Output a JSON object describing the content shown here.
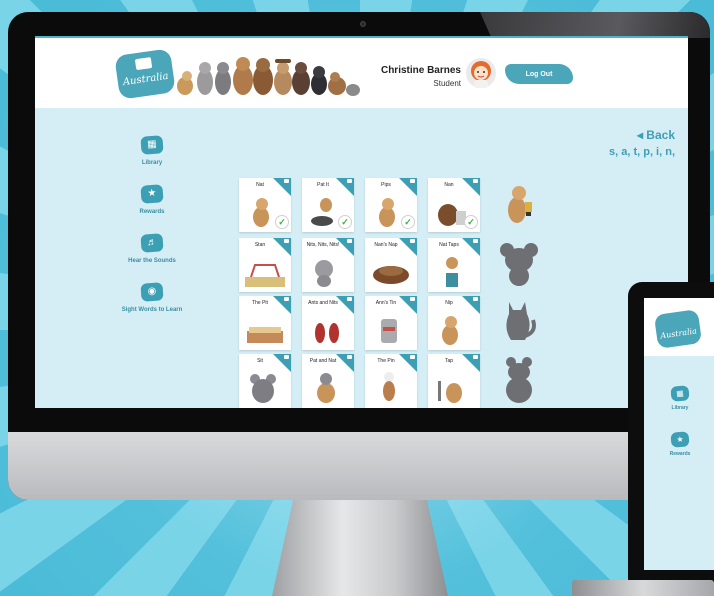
{
  "app": {
    "logo_text": "Australia",
    "user_name": "Christine Barnes",
    "user_role": "Student",
    "logout_label": "Log Out"
  },
  "sidebar": {
    "items": [
      {
        "label": "Library",
        "icon": "library-icon"
      },
      {
        "label": "Rewards",
        "icon": "trophy-icon"
      },
      {
        "label": "Hear the Sounds",
        "icon": "ear-icon"
      },
      {
        "label": "Sight Words to Learn",
        "icon": "eye-icon"
      }
    ]
  },
  "content": {
    "back_label": "◂ Back",
    "sounds": "s, a, t, p, i, n,"
  },
  "books": [
    {
      "title": "Nat",
      "completed": true
    },
    {
      "title": "Pat It",
      "completed": true
    },
    {
      "title": "Pips",
      "completed": true
    },
    {
      "title": "Nan",
      "completed": true
    },
    {
      "title": "Stan",
      "completed": false
    },
    {
      "title": "Nits, Nits, Nits!",
      "completed": false
    },
    {
      "title": "Nan's Nap",
      "completed": false
    },
    {
      "title": "Nat Taps",
      "completed": false
    },
    {
      "title": "The Pit",
      "completed": false
    },
    {
      "title": "Ants and Nits",
      "completed": false
    },
    {
      "title": "Ann's Tin",
      "completed": false
    },
    {
      "title": "Nip",
      "completed": false
    },
    {
      "title": "Sit",
      "completed": false
    },
    {
      "title": "Pat and Nat",
      "completed": false
    },
    {
      "title": "The Pin",
      "completed": false
    },
    {
      "title": "Tap",
      "completed": false
    }
  ],
  "tablet": {
    "logo_text": "Australia",
    "items": [
      {
        "label": "Library"
      },
      {
        "label": "Rewards"
      }
    ]
  },
  "colors": {
    "accent": "#3d9fb3",
    "screen_bg": "#d5eef6",
    "check": "#3cb043"
  }
}
